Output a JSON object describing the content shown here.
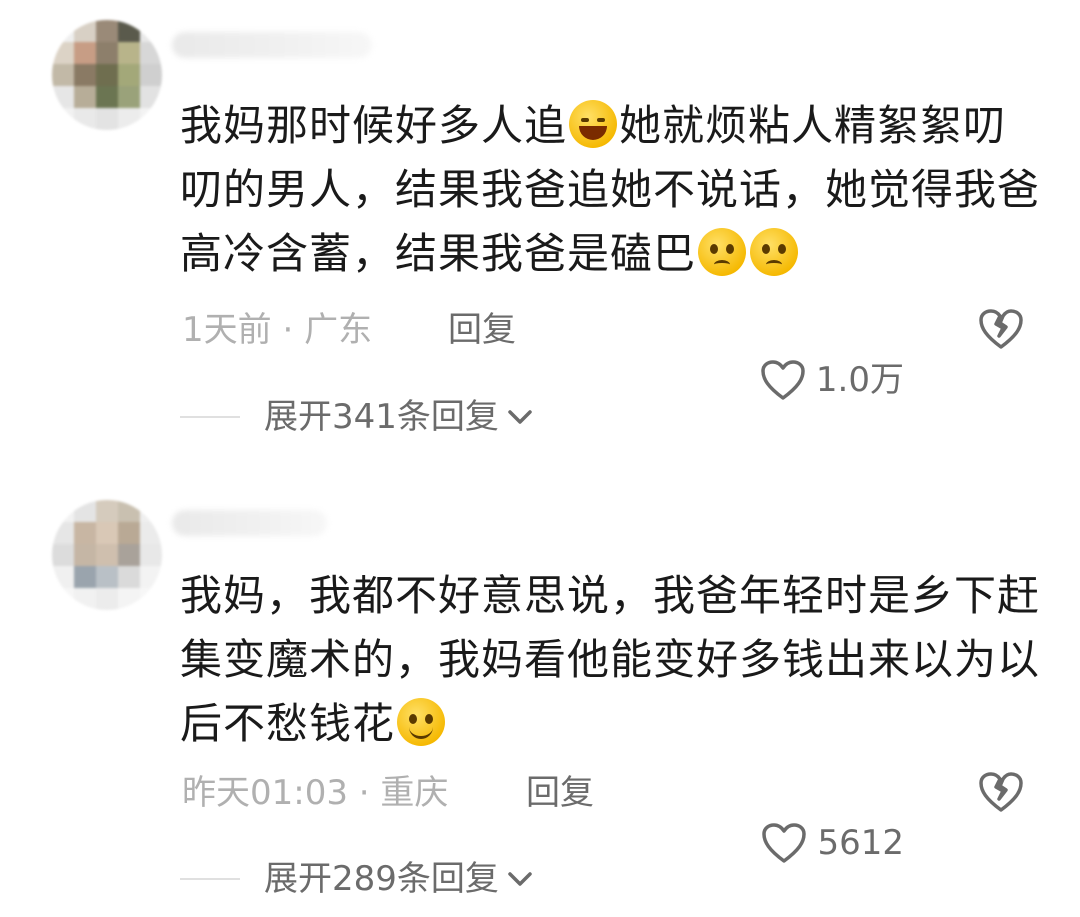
{
  "comments": [
    {
      "avatar_colors": [
        "#efefef",
        "#d8d0c5",
        "#9a8a78",
        "#5a5a4c",
        "#e8e8e8",
        "#dcd3c6",
        "#c79d85",
        "#8d7f6b",
        "#b8b48a",
        "#d7d7d7",
        "#c2b9a7",
        "#8a7a64",
        "#6f6e4f",
        "#a3a879",
        "#cfcfcf",
        "#e6e6e6",
        "#b7ad98",
        "#6b7552",
        "#9aa27a",
        "#e2e2e2",
        "#f1f1f1",
        "#e9e9e9",
        "#e3e3e3",
        "#ececec",
        "#f3f3f3"
      ],
      "text_parts": [
        "我妈那时候好多人追",
        "她就烦粘人精絮絮叨叨的男人，结果我爸追她不说话，她觉得我爸高冷含蓄，结果我爸是磕巴"
      ],
      "time": "1天前",
      "location": "广东",
      "reply_label": "回复",
      "likes": "1.0万",
      "expand_label": "展开341条回复"
    },
    {
      "avatar_colors": [
        "#f2f2f2",
        "#e4e4e4",
        "#d5cbbd",
        "#c9c0b0",
        "#efefef",
        "#e6e6e6",
        "#c8b6a3",
        "#d9c8b6",
        "#b9a995",
        "#ebebeb",
        "#dcdcdc",
        "#c5b6a5",
        "#cfbfae",
        "#a9a29a",
        "#e8e8e8",
        "#f0f0f0",
        "#9aa4ad",
        "#b9c0c6",
        "#dadada",
        "#f3f3f3",
        "#f6f6f6",
        "#f1f1f1",
        "#ececec",
        "#f4f4f4",
        "#f7f7f7"
      ],
      "text_parts": [
        "我妈，我都不好意思说，我爸年轻时是乡下赶集变魔术的，我妈看他能变好多钱出来以为以后不愁钱花"
      ],
      "time": "昨天01:03",
      "location": "重庆",
      "reply_label": "回复",
      "likes": "5612",
      "expand_label": "展开289条回复"
    }
  ],
  "separator": " · "
}
